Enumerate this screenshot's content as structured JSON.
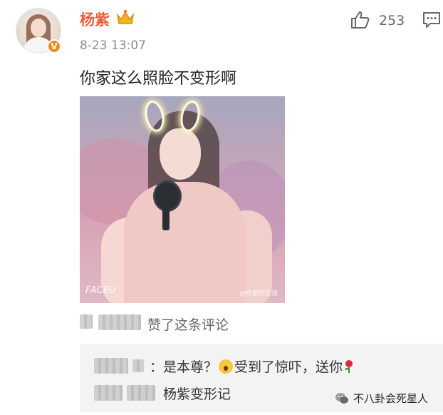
{
  "post": {
    "username": "杨紫",
    "timestamp": "8-23 13:07",
    "like_count": "253",
    "text": "你家这么照脸不变形啊"
  },
  "photo": {
    "watermark_left": "FACEU",
    "watermark_right": "@杨紫的影迷"
  },
  "liked_by": {
    "text": "赞了这条评论"
  },
  "replies": [
    {
      "text_before": "：是本尊？",
      "text_after": "受到了惊吓，送你"
    },
    {
      "text": "杨紫变形记"
    }
  ],
  "footer": {
    "brand": "不八卦会死星人"
  },
  "colors": {
    "username": "#e8603c",
    "verified_badge": "#f08b1c",
    "reply_background": "#f3f3f3"
  },
  "icons": [
    "crown-icon",
    "verified-icon",
    "like-icon",
    "comment-icon",
    "surprised-emoji",
    "rose-emoji",
    "wechat-icon"
  ]
}
